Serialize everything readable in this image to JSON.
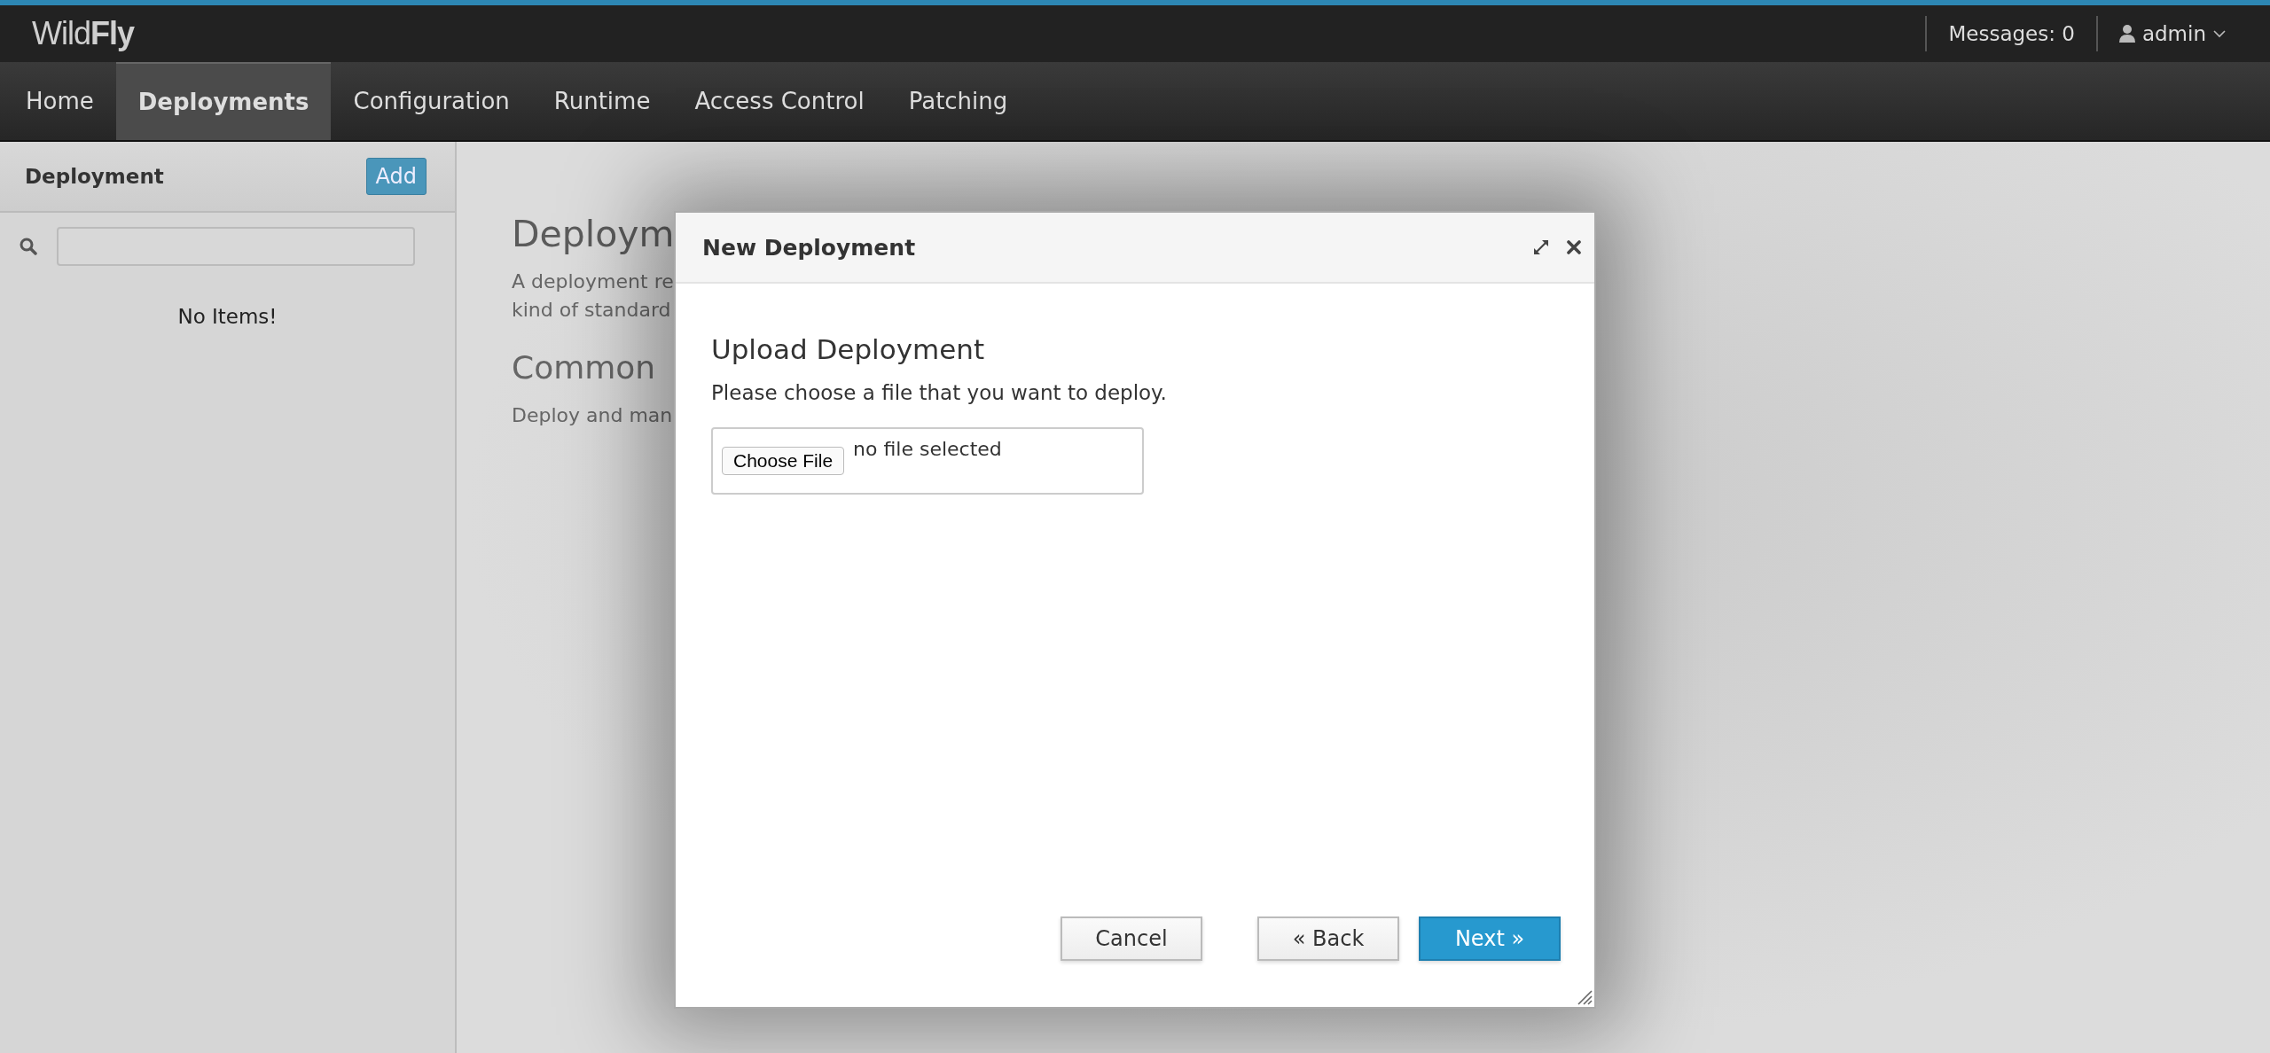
{
  "brand": "Wild**Fly**",
  "header": {
    "messages": "Messages: 0",
    "user": "admin"
  },
  "nav": [
    {
      "label": "Home",
      "selected": false
    },
    {
      "label": "Deployments",
      "selected": true
    },
    {
      "label": "Configuration",
      "selected": false
    },
    {
      "label": "Runtime",
      "selected": false
    },
    {
      "label": "Access Control",
      "selected": false
    },
    {
      "label": "Patching",
      "selected": false
    }
  ],
  "sidebar": {
    "title": "Deployment",
    "add_button": "Add",
    "empty_text": "No Items!"
  },
  "main": {
    "title": "Deploym",
    "description_lines": [
      "A deployment re",
      "kind of standard"
    ],
    "section_title": "Common",
    "section_text": "Deploy and man"
  },
  "dialog": {
    "title": "New Deployment",
    "heading": "Upload Deployment",
    "description": "Please choose a file that you want to deploy.",
    "file_input": {
      "button": "Choose File",
      "status": "no file selected"
    },
    "buttons": [
      {
        "label": "Cancel",
        "kind": "secondary"
      },
      {
        "label": "« Back",
        "kind": "secondary"
      },
      {
        "label": "Next »",
        "kind": "primary"
      }
    ]
  }
}
